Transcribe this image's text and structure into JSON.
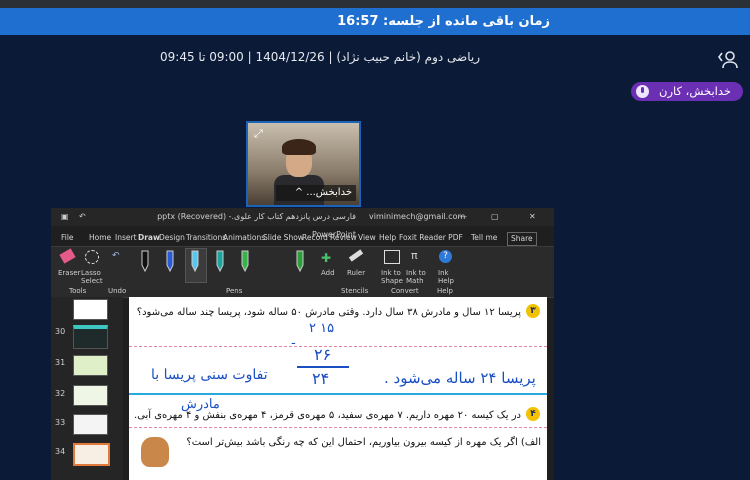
{
  "timer": {
    "label": "زمان باقی مانده از جلسه: 16:57"
  },
  "session": {
    "info": "ریاضی دوم (خانم حبیب نژاد) | 1404/12/26 | 09:00 تا 09:45"
  },
  "participant": {
    "name": "خدابخش، کارن"
  },
  "camera": {
    "label": "خدابخش..."
  },
  "powerpoint": {
    "filename": "فارسی درس پانزدهم کتاب کار علوی.pptx (Recovered) - PowerPoint",
    "user": "viminimech@gmail.com",
    "menu": [
      "File",
      "Home",
      "Insert",
      "Draw",
      "Design",
      "Transitions",
      "Animations",
      "Slide Show",
      "Record",
      "Review",
      "View",
      "Help",
      "Foxit Reader PDF",
      "Tell me"
    ],
    "share": "Share",
    "ribbon": {
      "eraser": "Eraser",
      "lasso": "Lasso Select",
      "tools": "Tools",
      "undo": "Undo",
      "add": "Add",
      "pens": "Pens",
      "ruler": "Ruler",
      "stencils": "Stencils",
      "ink_shape": "Ink to Shape",
      "ink_math": "Ink to Math",
      "convert": "Convert",
      "ink_help": "Ink Help",
      "help": "Help"
    },
    "slides": [
      "30",
      "31",
      "32",
      "33",
      "34"
    ],
    "slide": {
      "q1": "پریسا ۱۲ سال و مادرش ۳۸ سال دارد. وقتی مادرش ۵۰ ساله شود، پریسا چند ساله می‌شود؟",
      "q2": "در یک کیسه ۲۰ مهره داریم. ۷ مهره‌ی سفید، ۵ مهره‌ی قرمز، ۴ مهره‌ی بنفش و ۴ مهره‌ی آبی.",
      "q3": "الف) اگر یک مهره از کیسه بیرون بیاوریم، احتمال این که چه رنگی باشد بیش‌تر است؟",
      "n1": "۳",
      "n2": "۴",
      "hw_top": "۲ ۱۵",
      "hw_sub": "۲۶",
      "hw_res": "۲۴",
      "hw_answer": "پریسا ۲۴ ساله می‌شود .",
      "hw_diff": "تفاوت سنی پریسا با",
      "hw_mother": "مادرش"
    }
  }
}
